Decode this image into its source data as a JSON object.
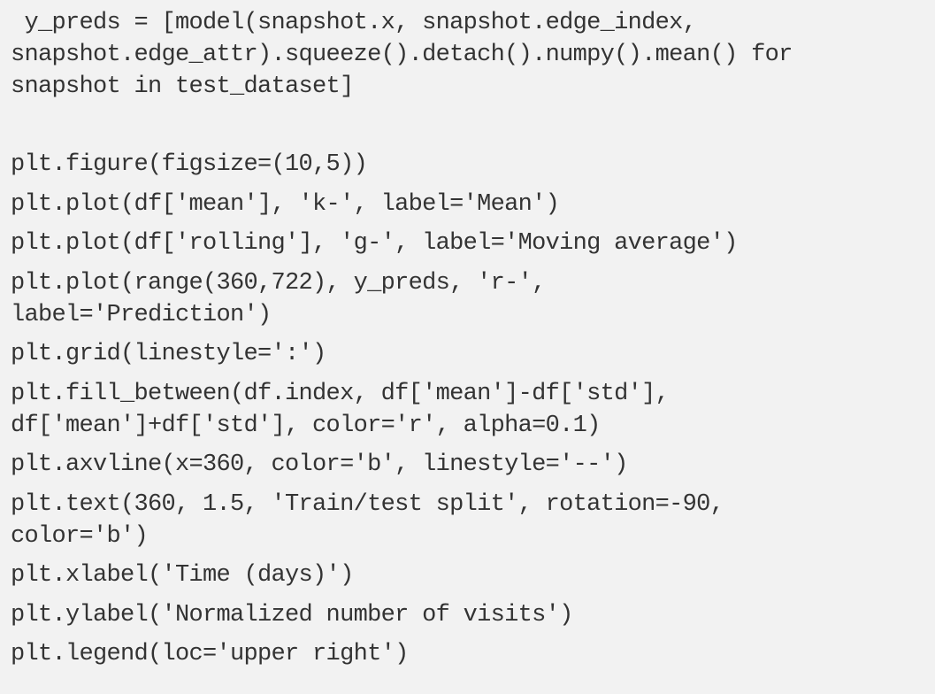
{
  "code": {
    "l01": " y_preds = [model(snapshot.x, snapshot.edge_index,",
    "l02": "snapshot.edge_attr).squeeze().detach().numpy().mean() for",
    "l03": "snapshot in test_dataset]",
    "l04": "plt.figure(figsize=(10,5))",
    "l05": "plt.plot(df['mean'], 'k-', label='Mean')",
    "l06": "plt.plot(df['rolling'], 'g-', label='Moving average')",
    "l07": "plt.plot(range(360,722), y_preds, 'r-',",
    "l08": "label='Prediction')",
    "l09": "plt.grid(linestyle=':')",
    "l10": "plt.fill_between(df.index, df['mean']-df['std'],",
    "l11": "df['mean']+df['std'], color='r', alpha=0.1)",
    "l12": "plt.axvline(x=360, color='b', linestyle='--')",
    "l13": "plt.text(360, 1.5, 'Train/test split', rotation=-90,",
    "l14": "color='b')",
    "l15": "plt.xlabel('Time (days)')",
    "l16": "plt.ylabel('Normalized number of visits')",
    "l17": "plt.legend(loc='upper right')"
  }
}
